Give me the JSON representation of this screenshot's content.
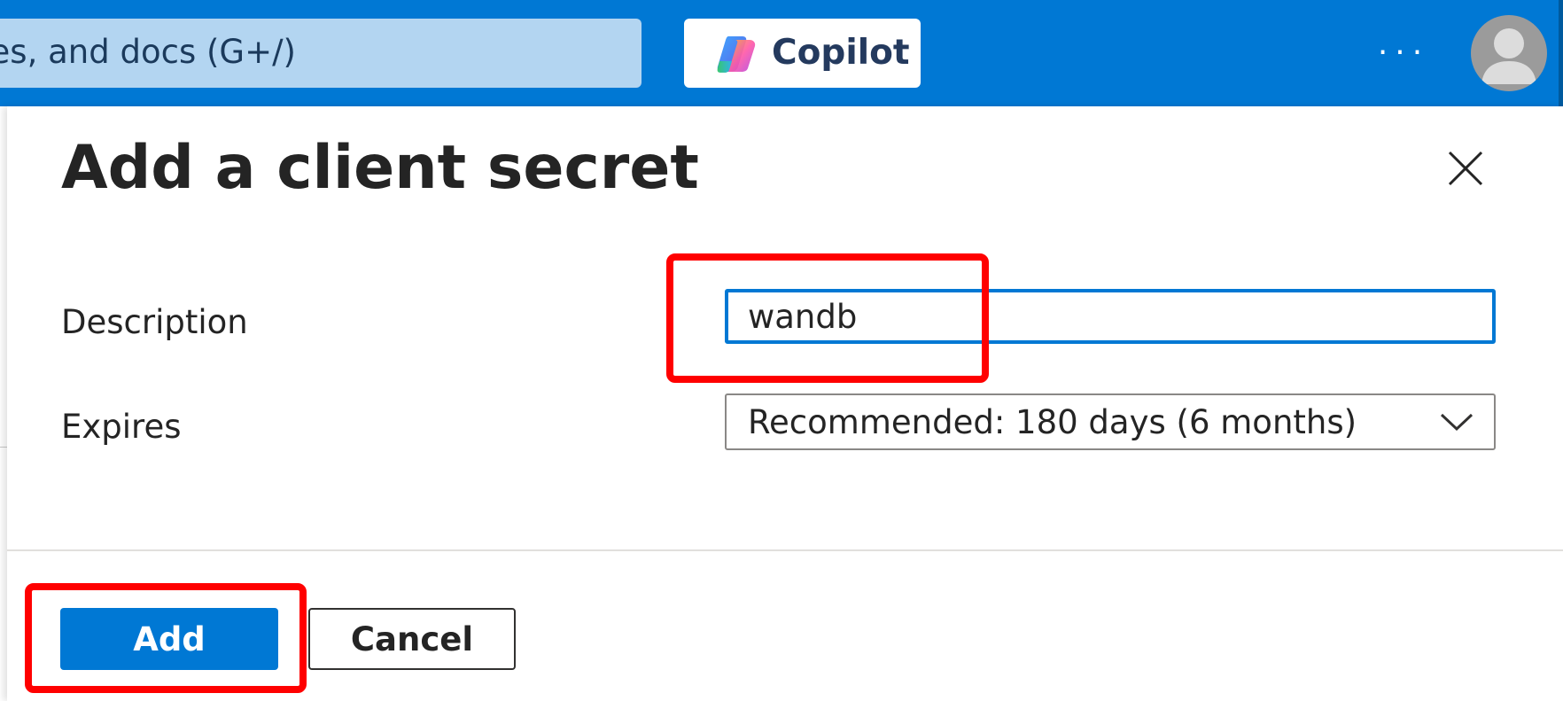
{
  "topbar": {
    "search_text": "ces, and docs (G+/)",
    "copilot_label": "Copilot",
    "more_label": "···",
    "accent_color": "#0078d4",
    "icons": {
      "copilot": "copilot-icon",
      "avatar": "user-avatar-icon"
    }
  },
  "panel": {
    "title": "Add a client secret",
    "description_label": "Description",
    "description_value": "wandb",
    "expires_label": "Expires",
    "expires_value": "Recommended: 180 days (6 months)",
    "add_label": "Add",
    "cancel_label": "Cancel",
    "icons": {
      "close": "close-icon",
      "dropdown": "chevron-down-icon"
    }
  },
  "annotations": {
    "highlight_color": "#ff0000"
  }
}
